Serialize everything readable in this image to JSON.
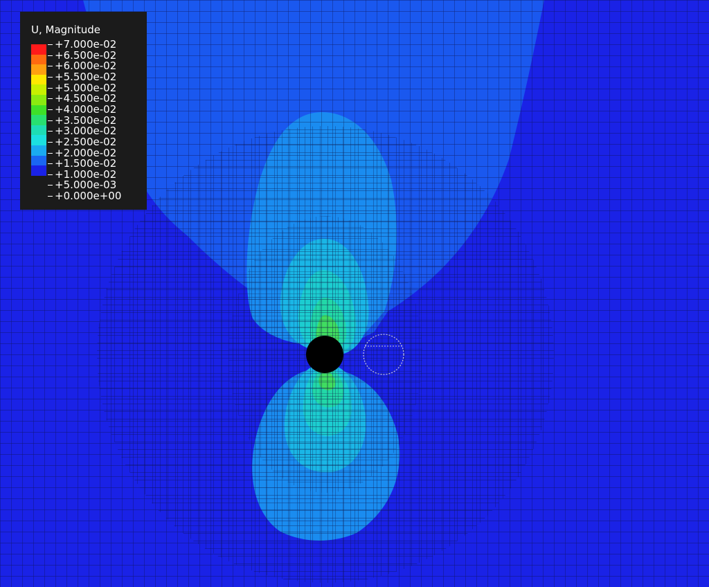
{
  "legend": {
    "title": "U, Magnitude",
    "ticks": [
      "+7.000e-02",
      "+6.500e-02",
      "+6.000e-02",
      "+5.500e-02",
      "+5.000e-02",
      "+4.500e-02",
      "+4.000e-02",
      "+3.500e-02",
      "+3.000e-02",
      "+2.500e-02",
      "+2.000e-02",
      "+1.500e-02",
      "+1.000e-02",
      "+5.000e-03",
      "+0.000e+00"
    ],
    "colors": [
      "#ff1a1a",
      "#ff6a10",
      "#ffa010",
      "#ffe800",
      "#c8f000",
      "#8aea10",
      "#3ee028",
      "#28e070",
      "#1eddb4",
      "#1ce0e0",
      "#1aaaf0",
      "#1a66f2",
      "#1a22e6"
    ]
  },
  "contour_colors": {
    "background": "#1a22e6",
    "band_0.5": "#1a58ef",
    "band_1.0": "#1a8cf0",
    "band_1.5": "#1ab6e6",
    "band_2.0": "#1ccdd0",
    "band_2.5": "#22d8a8",
    "band_3.0": "#40dd60",
    "mesh_line": "#0b1040",
    "hole": "#000000",
    "dashed_circle": "#c8c8d8"
  }
}
